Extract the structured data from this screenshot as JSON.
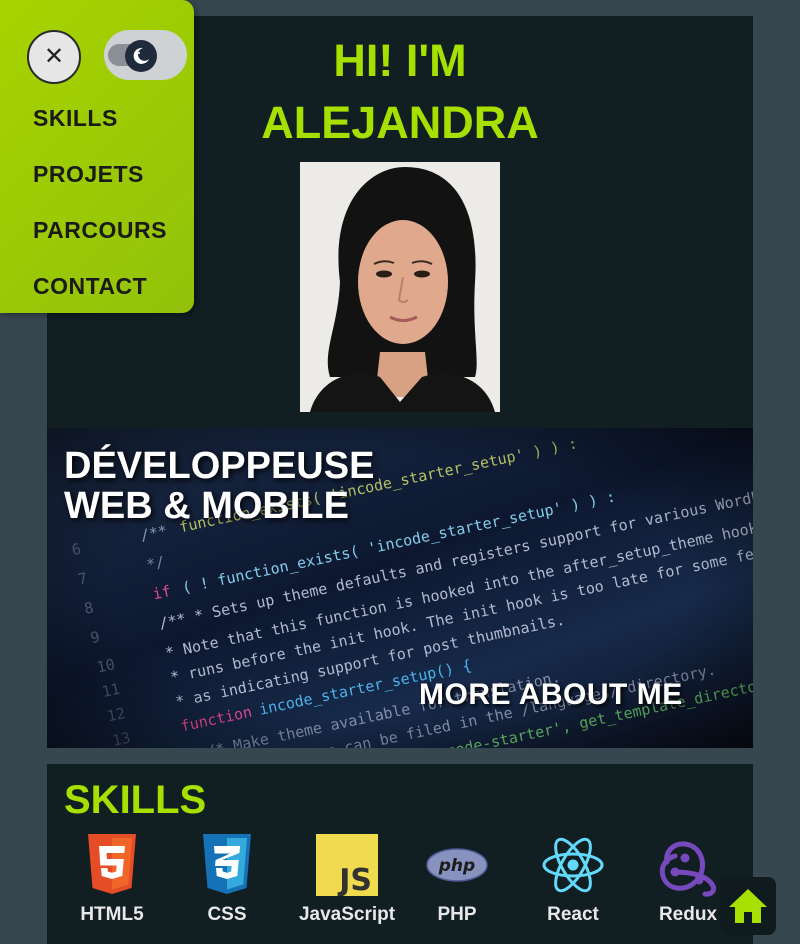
{
  "hero": {
    "title_line1": "HI! I'M",
    "title_line2": "ALEJANDRA"
  },
  "banner": {
    "title_line1": "DÉVELOPPEUSE",
    "title_line2": "WEB & MOBILE",
    "more_label": "MORE ABOUT ME"
  },
  "skills": {
    "title": "SKILLS",
    "items": [
      {
        "label": "HTML5",
        "icon": "html5-icon"
      },
      {
        "label": "CSS",
        "icon": "css3-icon"
      },
      {
        "label": "JavaScript",
        "icon": "javascript-icon"
      },
      {
        "label": "PHP",
        "icon": "php-icon"
      },
      {
        "label": "React",
        "icon": "react-icon"
      },
      {
        "label": "Redux",
        "icon": "redux-icon"
      }
    ]
  },
  "menu": {
    "items": [
      {
        "label": "SKILLS"
      },
      {
        "label": "PROJETS"
      },
      {
        "label": "PARCOURS"
      },
      {
        "label": "CONTACT"
      }
    ]
  },
  "colors": {
    "accent": "#a6e000",
    "background": "#37474f",
    "panel": "#111e22",
    "menu": "#a6d400"
  }
}
